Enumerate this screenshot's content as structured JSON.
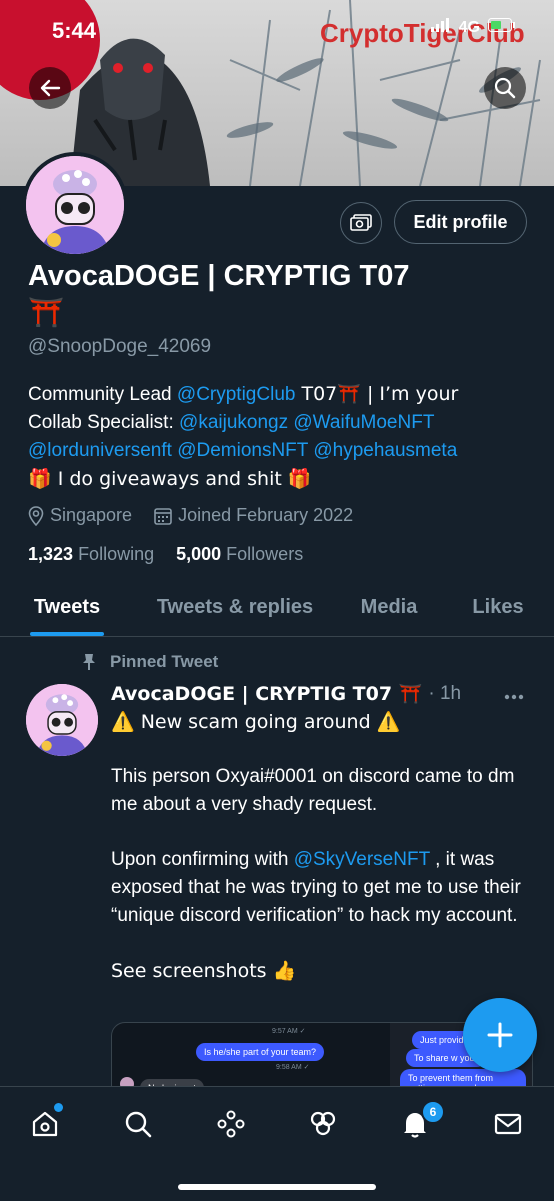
{
  "status_bar": {
    "time": "5:44",
    "network": "4G"
  },
  "banner": {
    "brand_text": "CryptoTigerClub"
  },
  "profile": {
    "display_name": "AvocaDOGE | CRYPTIG T07",
    "name_emoji": "⛩️",
    "handle": "@SnoopDoge_42069",
    "edit_button_label": "Edit profile",
    "bio": {
      "line1_prefix": "Community Lead ",
      "mention_cryptig": "@CryptigClub",
      "line1_suffix": " T07⛩️ | I’m your",
      "line2_prefix": "Collab Specialist: ",
      "mention_kaiju": "@kaijukongz",
      "mention_waifu": "@WaifuMoeNFT",
      "mention_lord": "@lorduniversenft",
      "mention_demions": "@DemionsNFT",
      "mention_hype": "@hypehausmeta",
      "line4": "🎁 I do giveaways and shit 🎁"
    },
    "location": "Singapore",
    "joined": "Joined February 2022",
    "following_count": "1,323",
    "following_label": "Following",
    "followers_count": "5,000",
    "followers_label": "Followers"
  },
  "tabs": [
    {
      "label": "Tweets",
      "active": true
    },
    {
      "label": "Tweets & replies",
      "active": false
    },
    {
      "label": "Media",
      "active": false
    },
    {
      "label": "Likes",
      "active": false
    }
  ],
  "pinned_tweet": {
    "pinned_label": "Pinned Tweet",
    "author_name": "AvocaDOGE | CRYPTIG T07 ⛩️",
    "time": "· 1h",
    "line1": "⚠️ New scam going around ⚠️",
    "para2": "This person Oxyai#0001 on discord came to dm me about a very shady request.",
    "para3_prefix": "Upon confirming with ",
    "para3_mention": "@SkyVerseNFT",
    "para3_suffix": " , it was exposed that he was trying to get me to use their “unique discord verification” to hack my account.",
    "para4": "See screenshots 👍",
    "media_texts": {
      "time1": "9:57 AM ✓",
      "q1": "Is he/she part of your team?",
      "time2": "9:58 AM ✓",
      "a1": "No he is not",
      "r1": "Just providing",
      "r2": "To share w your",
      "r3": "To prevent them from getting scammed"
    }
  },
  "bottom_nav": {
    "notifications_badge": "6"
  },
  "colors": {
    "background": "#15202b",
    "accent": "#1d9bf0",
    "muted": "#8899a6",
    "divider": "#38444d"
  }
}
